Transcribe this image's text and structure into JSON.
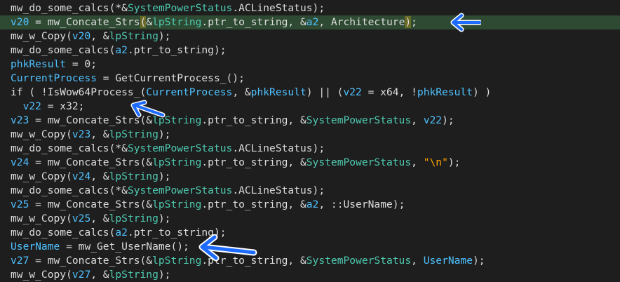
{
  "code_view": {
    "colors": {
      "background": "#1e1e1e",
      "default_text": "#dcdcdc",
      "local_variable": "#4fc1ff",
      "global_name": "#4ec9b0",
      "string_literal": "#ffa500",
      "current_line_highlight": "#2f4a33",
      "annotation_arrow": "#1e6bff"
    },
    "lines": [
      [
        {
          "t": "mw_do_some_calcs(*&",
          "k": "default"
        },
        {
          "t": "SystemPowerStatus",
          "k": "global"
        },
        {
          "t": ".ACLineStatus);",
          "k": "default"
        }
      ],
      [
        {
          "t": "v20",
          "k": "var"
        },
        {
          "t": " = mw_Concate_Strs",
          "k": "default"
        },
        {
          "t": "(",
          "k": "paren"
        },
        {
          "t": "&",
          "k": "default"
        },
        {
          "t": "lpString",
          "k": "global"
        },
        {
          "t": ".ptr_to_string, &",
          "k": "default"
        },
        {
          "t": "a2",
          "k": "var"
        },
        {
          "t": ", Architecture",
          "k": "default"
        },
        {
          "t": ")",
          "k": "paren"
        },
        {
          "t": ";",
          "k": "default"
        }
      ],
      [
        {
          "t": "mw_w_Copy(",
          "k": "default"
        },
        {
          "t": "v20",
          "k": "var"
        },
        {
          "t": ", &",
          "k": "default"
        },
        {
          "t": "lpString",
          "k": "global"
        },
        {
          "t": ");",
          "k": "default"
        }
      ],
      [
        {
          "t": "mw_do_some_calcs(",
          "k": "default"
        },
        {
          "t": "a2",
          "k": "var"
        },
        {
          "t": ".ptr_to_string);",
          "k": "default"
        }
      ],
      [
        {
          "t": "phkResult",
          "k": "var"
        },
        {
          "t": " = 0;",
          "k": "default"
        }
      ],
      [
        {
          "t": "CurrentProcess",
          "k": "var"
        },
        {
          "t": " = GetCurrentProcess_();",
          "k": "default"
        }
      ],
      [
        {
          "t": "if ( !IsWow64Process_(",
          "k": "default"
        },
        {
          "t": "CurrentProcess",
          "k": "var"
        },
        {
          "t": ", &",
          "k": "default"
        },
        {
          "t": "phkResult",
          "k": "var"
        },
        {
          "t": ") || (",
          "k": "default"
        },
        {
          "t": "v22",
          "k": "var"
        },
        {
          "t": " = x64, !",
          "k": "default"
        },
        {
          "t": "phkResult",
          "k": "var"
        },
        {
          "t": ") )",
          "k": "default"
        }
      ],
      [
        {
          "t": "  ",
          "k": "default"
        },
        {
          "t": "v22",
          "k": "var"
        },
        {
          "t": " = x32;",
          "k": "default"
        }
      ],
      [
        {
          "t": "v23",
          "k": "var"
        },
        {
          "t": " = mw_Concate_Strs(&",
          "k": "default"
        },
        {
          "t": "lpString",
          "k": "global"
        },
        {
          "t": ".ptr_to_string, &",
          "k": "default"
        },
        {
          "t": "SystemPowerStatus",
          "k": "global"
        },
        {
          "t": ", ",
          "k": "default"
        },
        {
          "t": "v22",
          "k": "var"
        },
        {
          "t": ");",
          "k": "default"
        }
      ],
      [
        {
          "t": "mw_w_Copy(",
          "k": "default"
        },
        {
          "t": "v23",
          "k": "var"
        },
        {
          "t": ", &",
          "k": "default"
        },
        {
          "t": "lpString",
          "k": "global"
        },
        {
          "t": ");",
          "k": "default"
        }
      ],
      [
        {
          "t": "mw_do_some_calcs(*&",
          "k": "default"
        },
        {
          "t": "SystemPowerStatus",
          "k": "global"
        },
        {
          "t": ".ACLineStatus);",
          "k": "default"
        }
      ],
      [
        {
          "t": "v24",
          "k": "var"
        },
        {
          "t": " = mw_Concate_Strs(&",
          "k": "default"
        },
        {
          "t": "lpString",
          "k": "global"
        },
        {
          "t": ".ptr_to_string, &",
          "k": "default"
        },
        {
          "t": "SystemPowerStatus",
          "k": "global"
        },
        {
          "t": ", ",
          "k": "default"
        },
        {
          "t": "\"\\n\"",
          "k": "string"
        },
        {
          "t": ");",
          "k": "default"
        }
      ],
      [
        {
          "t": "mw_w_Copy(",
          "k": "default"
        },
        {
          "t": "v24",
          "k": "var"
        },
        {
          "t": ", &",
          "k": "default"
        },
        {
          "t": "lpString",
          "k": "global"
        },
        {
          "t": ");",
          "k": "default"
        }
      ],
      [
        {
          "t": "mw_do_some_calcs(*&",
          "k": "default"
        },
        {
          "t": "SystemPowerStatus",
          "k": "global"
        },
        {
          "t": ".ACLineStatus);",
          "k": "default"
        }
      ],
      [
        {
          "t": "v25",
          "k": "var"
        },
        {
          "t": " = mw_Concate_Strs(&",
          "k": "default"
        },
        {
          "t": "lpString",
          "k": "global"
        },
        {
          "t": ".ptr_to_string, &",
          "k": "default"
        },
        {
          "t": "a2",
          "k": "var"
        },
        {
          "t": ", ::UserName);",
          "k": "default"
        }
      ],
      [
        {
          "t": "mw_w_Copy(",
          "k": "default"
        },
        {
          "t": "v25",
          "k": "var"
        },
        {
          "t": ", &",
          "k": "default"
        },
        {
          "t": "lpString",
          "k": "global"
        },
        {
          "t": ");",
          "k": "default"
        }
      ],
      [
        {
          "t": "mw_do_some_calcs(",
          "k": "default"
        },
        {
          "t": "a2",
          "k": "var"
        },
        {
          "t": ".ptr_to_string);",
          "k": "default"
        }
      ],
      [
        {
          "t": "UserName",
          "k": "var"
        },
        {
          "t": " = mw_Get_UserName();",
          "k": "default"
        }
      ],
      [
        {
          "t": "v27",
          "k": "var"
        },
        {
          "t": " = mw_Concate_Strs(&",
          "k": "default"
        },
        {
          "t": "lpString",
          "k": "global"
        },
        {
          "t": ".ptr_to_string, &",
          "k": "default"
        },
        {
          "t": "SystemPowerStatus",
          "k": "global"
        },
        {
          "t": ", ",
          "k": "default"
        },
        {
          "t": "UserName",
          "k": "var"
        },
        {
          "t": ");",
          "k": "default"
        }
      ],
      [
        {
          "t": "mw_w_Copy(",
          "k": "default"
        },
        {
          "t": "v27",
          "k": "var"
        },
        {
          "t": ", &",
          "k": "default"
        },
        {
          "t": "lpString",
          "k": "global"
        },
        {
          "t": ");",
          "k": "default"
        }
      ]
    ],
    "highlighted_line": 1,
    "annotations": [
      {
        "name": "arrow-architecture",
        "line": 1,
        "icon": "left-arrow-icon"
      },
      {
        "name": "arrow-x32",
        "line": 7,
        "icon": "left-arrow-icon"
      },
      {
        "name": "arrow-username",
        "line": 17,
        "icon": "left-arrow-icon"
      }
    ]
  }
}
